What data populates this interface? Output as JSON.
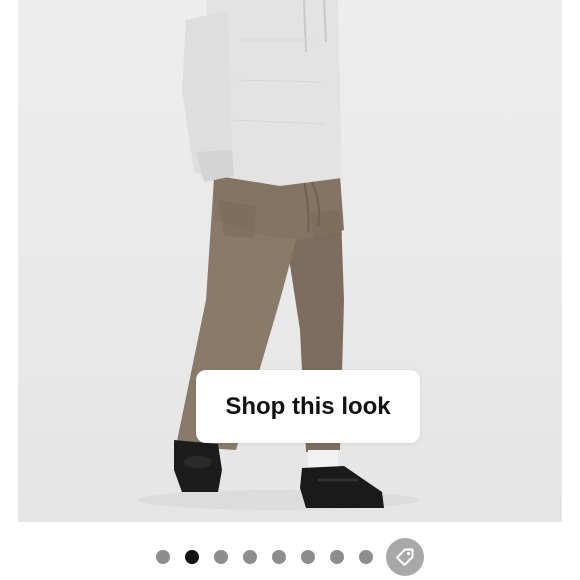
{
  "product_image": {
    "alt_icon": "model-photo",
    "shop_button_label": "Shop this look"
  },
  "carousel": {
    "slide_count": 8,
    "active_index": 1,
    "tag_icon": "tag-icon",
    "colors": {
      "active_dot": "#111111",
      "inactive_dot": "#8d8d8d",
      "tag_button": "#a8a8a8"
    }
  }
}
